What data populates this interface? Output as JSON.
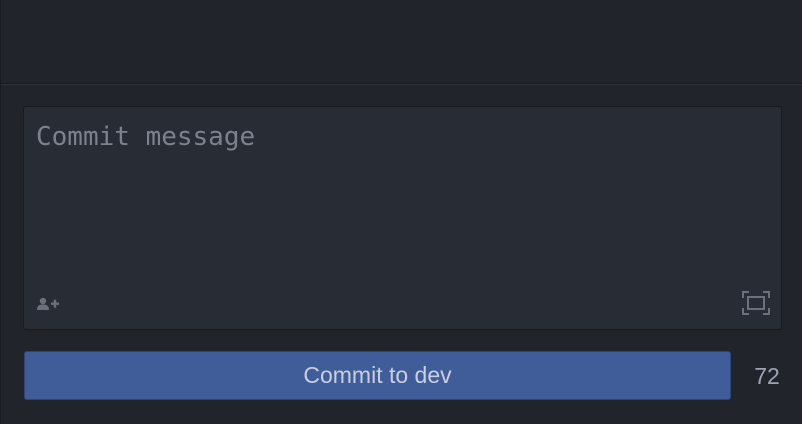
{
  "commit_panel": {
    "message": {
      "placeholder": "Commit message",
      "value": ""
    },
    "coauthor_icon": "person-add-icon",
    "expand_icon": "expand-icon",
    "commit_button": {
      "label": "Commit to dev"
    },
    "character_count": "72"
  },
  "colors": {
    "background": "#21252b",
    "editor_background": "#282c34",
    "border": "#181a1f",
    "button_background": "#415d99",
    "button_text": "#c7cfe0",
    "placeholder_text": "#7c828d",
    "count_text": "#9da5b4",
    "icon": "#6b717c"
  }
}
